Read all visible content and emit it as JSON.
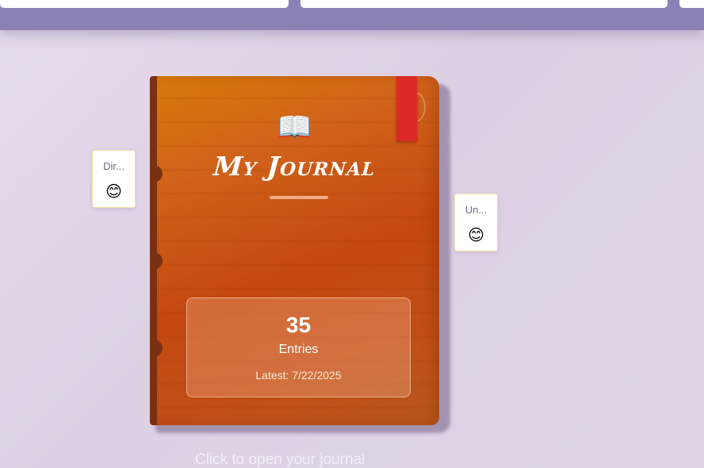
{
  "top_cards": [
    "",
    "",
    ""
  ],
  "book": {
    "icon": "📖",
    "icon_name": "open-book-icon",
    "title": "My Journal",
    "entry_count": "35",
    "entries_label": "Entries",
    "latest": "Latest: 7/22/2025",
    "cover_color": "#c8501a",
    "ribbon_color": "#dc2a28"
  },
  "notes": [
    {
      "title": "Dir...",
      "emoji": "😊",
      "emoji_name": "smiling-face-icon"
    },
    {
      "title": "Un...",
      "emoji": "😊",
      "emoji_name": "smiling-face-icon"
    }
  ],
  "hint": "Click to open your journal"
}
